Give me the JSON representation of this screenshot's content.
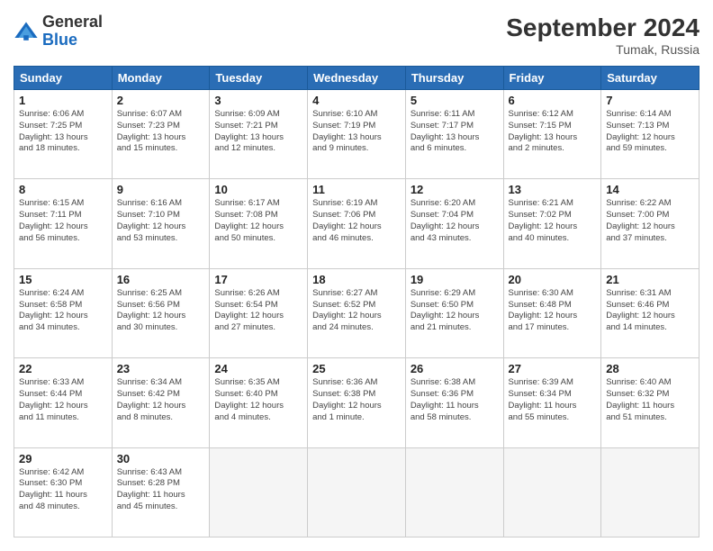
{
  "header": {
    "logo_general": "General",
    "logo_blue": "Blue",
    "title": "September 2024",
    "location": "Tumak, Russia"
  },
  "days_of_week": [
    "Sunday",
    "Monday",
    "Tuesday",
    "Wednesday",
    "Thursday",
    "Friday",
    "Saturday"
  ],
  "weeks": [
    [
      {
        "day": 1,
        "info": "Sunrise: 6:06 AM\nSunset: 7:25 PM\nDaylight: 13 hours\nand 18 minutes."
      },
      {
        "day": 2,
        "info": "Sunrise: 6:07 AM\nSunset: 7:23 PM\nDaylight: 13 hours\nand 15 minutes."
      },
      {
        "day": 3,
        "info": "Sunrise: 6:09 AM\nSunset: 7:21 PM\nDaylight: 13 hours\nand 12 minutes."
      },
      {
        "day": 4,
        "info": "Sunrise: 6:10 AM\nSunset: 7:19 PM\nDaylight: 13 hours\nand 9 minutes."
      },
      {
        "day": 5,
        "info": "Sunrise: 6:11 AM\nSunset: 7:17 PM\nDaylight: 13 hours\nand 6 minutes."
      },
      {
        "day": 6,
        "info": "Sunrise: 6:12 AM\nSunset: 7:15 PM\nDaylight: 13 hours\nand 2 minutes."
      },
      {
        "day": 7,
        "info": "Sunrise: 6:14 AM\nSunset: 7:13 PM\nDaylight: 12 hours\nand 59 minutes."
      }
    ],
    [
      {
        "day": 8,
        "info": "Sunrise: 6:15 AM\nSunset: 7:11 PM\nDaylight: 12 hours\nand 56 minutes."
      },
      {
        "day": 9,
        "info": "Sunrise: 6:16 AM\nSunset: 7:10 PM\nDaylight: 12 hours\nand 53 minutes."
      },
      {
        "day": 10,
        "info": "Sunrise: 6:17 AM\nSunset: 7:08 PM\nDaylight: 12 hours\nand 50 minutes."
      },
      {
        "day": 11,
        "info": "Sunrise: 6:19 AM\nSunset: 7:06 PM\nDaylight: 12 hours\nand 46 minutes."
      },
      {
        "day": 12,
        "info": "Sunrise: 6:20 AM\nSunset: 7:04 PM\nDaylight: 12 hours\nand 43 minutes."
      },
      {
        "day": 13,
        "info": "Sunrise: 6:21 AM\nSunset: 7:02 PM\nDaylight: 12 hours\nand 40 minutes."
      },
      {
        "day": 14,
        "info": "Sunrise: 6:22 AM\nSunset: 7:00 PM\nDaylight: 12 hours\nand 37 minutes."
      }
    ],
    [
      {
        "day": 15,
        "info": "Sunrise: 6:24 AM\nSunset: 6:58 PM\nDaylight: 12 hours\nand 34 minutes."
      },
      {
        "day": 16,
        "info": "Sunrise: 6:25 AM\nSunset: 6:56 PM\nDaylight: 12 hours\nand 30 minutes."
      },
      {
        "day": 17,
        "info": "Sunrise: 6:26 AM\nSunset: 6:54 PM\nDaylight: 12 hours\nand 27 minutes."
      },
      {
        "day": 18,
        "info": "Sunrise: 6:27 AM\nSunset: 6:52 PM\nDaylight: 12 hours\nand 24 minutes."
      },
      {
        "day": 19,
        "info": "Sunrise: 6:29 AM\nSunset: 6:50 PM\nDaylight: 12 hours\nand 21 minutes."
      },
      {
        "day": 20,
        "info": "Sunrise: 6:30 AM\nSunset: 6:48 PM\nDaylight: 12 hours\nand 17 minutes."
      },
      {
        "day": 21,
        "info": "Sunrise: 6:31 AM\nSunset: 6:46 PM\nDaylight: 12 hours\nand 14 minutes."
      }
    ],
    [
      {
        "day": 22,
        "info": "Sunrise: 6:33 AM\nSunset: 6:44 PM\nDaylight: 12 hours\nand 11 minutes."
      },
      {
        "day": 23,
        "info": "Sunrise: 6:34 AM\nSunset: 6:42 PM\nDaylight: 12 hours\nand 8 minutes."
      },
      {
        "day": 24,
        "info": "Sunrise: 6:35 AM\nSunset: 6:40 PM\nDaylight: 12 hours\nand 4 minutes."
      },
      {
        "day": 25,
        "info": "Sunrise: 6:36 AM\nSunset: 6:38 PM\nDaylight: 12 hours\nand 1 minute."
      },
      {
        "day": 26,
        "info": "Sunrise: 6:38 AM\nSunset: 6:36 PM\nDaylight: 11 hours\nand 58 minutes."
      },
      {
        "day": 27,
        "info": "Sunrise: 6:39 AM\nSunset: 6:34 PM\nDaylight: 11 hours\nand 55 minutes."
      },
      {
        "day": 28,
        "info": "Sunrise: 6:40 AM\nSunset: 6:32 PM\nDaylight: 11 hours\nand 51 minutes."
      }
    ],
    [
      {
        "day": 29,
        "info": "Sunrise: 6:42 AM\nSunset: 6:30 PM\nDaylight: 11 hours\nand 48 minutes."
      },
      {
        "day": 30,
        "info": "Sunrise: 6:43 AM\nSunset: 6:28 PM\nDaylight: 11 hours\nand 45 minutes."
      },
      null,
      null,
      null,
      null,
      null
    ]
  ]
}
